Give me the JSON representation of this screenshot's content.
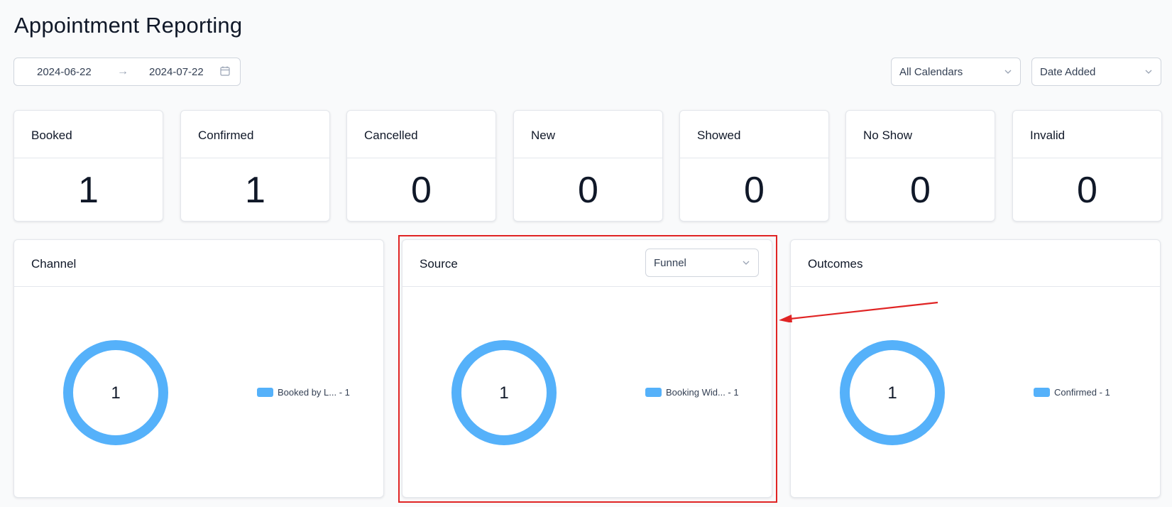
{
  "page": {
    "title": "Appointment Reporting"
  },
  "filters": {
    "date_start": "2024-06-22",
    "date_end": "2024-07-22",
    "calendar_select": "All Calendars",
    "date_type_select": "Date Added"
  },
  "stats": [
    {
      "label": "Booked",
      "value": "1"
    },
    {
      "label": "Confirmed",
      "value": "1"
    },
    {
      "label": "Cancelled",
      "value": "0"
    },
    {
      "label": "New",
      "value": "0"
    },
    {
      "label": "Showed",
      "value": "0"
    },
    {
      "label": "No Show",
      "value": "0"
    },
    {
      "label": "Invalid",
      "value": "0"
    }
  ],
  "panels": {
    "channel": {
      "title": "Channel",
      "total": "1",
      "legend": "Booked by L... - 1"
    },
    "source": {
      "title": "Source",
      "filter": "Funnel",
      "total": "1",
      "legend": "Booking Wid... - 1"
    },
    "outcomes": {
      "title": "Outcomes",
      "total": "1",
      "legend": "Confirmed - 1"
    }
  },
  "colors": {
    "donut": "#55b1fa",
    "highlight": "#e02424"
  },
  "icons": {
    "date_separator": "arrow-right-icon",
    "calendar": "calendar-icon",
    "dropdown": "chevron-down-icon"
  }
}
